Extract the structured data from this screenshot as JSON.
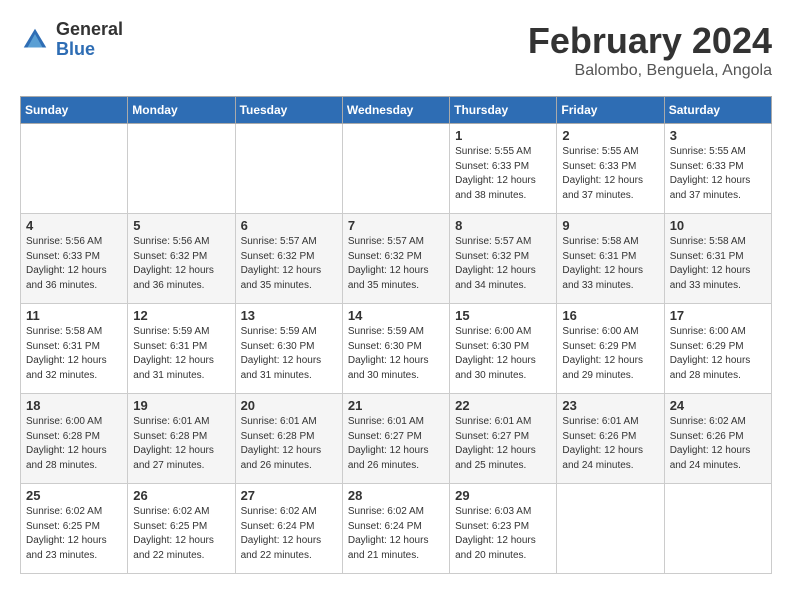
{
  "logo": {
    "general": "General",
    "blue": "Blue"
  },
  "title": "February 2024",
  "location": "Balombo, Benguela, Angola",
  "headers": [
    "Sunday",
    "Monday",
    "Tuesday",
    "Wednesday",
    "Thursday",
    "Friday",
    "Saturday"
  ],
  "weeks": [
    [
      {
        "day": "",
        "info": ""
      },
      {
        "day": "",
        "info": ""
      },
      {
        "day": "",
        "info": ""
      },
      {
        "day": "",
        "info": ""
      },
      {
        "day": "1",
        "info": "Sunrise: 5:55 AM\nSunset: 6:33 PM\nDaylight: 12 hours\nand 38 minutes."
      },
      {
        "day": "2",
        "info": "Sunrise: 5:55 AM\nSunset: 6:33 PM\nDaylight: 12 hours\nand 37 minutes."
      },
      {
        "day": "3",
        "info": "Sunrise: 5:55 AM\nSunset: 6:33 PM\nDaylight: 12 hours\nand 37 minutes."
      }
    ],
    [
      {
        "day": "4",
        "info": "Sunrise: 5:56 AM\nSunset: 6:33 PM\nDaylight: 12 hours\nand 36 minutes."
      },
      {
        "day": "5",
        "info": "Sunrise: 5:56 AM\nSunset: 6:32 PM\nDaylight: 12 hours\nand 36 minutes."
      },
      {
        "day": "6",
        "info": "Sunrise: 5:57 AM\nSunset: 6:32 PM\nDaylight: 12 hours\nand 35 minutes."
      },
      {
        "day": "7",
        "info": "Sunrise: 5:57 AM\nSunset: 6:32 PM\nDaylight: 12 hours\nand 35 minutes."
      },
      {
        "day": "8",
        "info": "Sunrise: 5:57 AM\nSunset: 6:32 PM\nDaylight: 12 hours\nand 34 minutes."
      },
      {
        "day": "9",
        "info": "Sunrise: 5:58 AM\nSunset: 6:31 PM\nDaylight: 12 hours\nand 33 minutes."
      },
      {
        "day": "10",
        "info": "Sunrise: 5:58 AM\nSunset: 6:31 PM\nDaylight: 12 hours\nand 33 minutes."
      }
    ],
    [
      {
        "day": "11",
        "info": "Sunrise: 5:58 AM\nSunset: 6:31 PM\nDaylight: 12 hours\nand 32 minutes."
      },
      {
        "day": "12",
        "info": "Sunrise: 5:59 AM\nSunset: 6:31 PM\nDaylight: 12 hours\nand 31 minutes."
      },
      {
        "day": "13",
        "info": "Sunrise: 5:59 AM\nSunset: 6:30 PM\nDaylight: 12 hours\nand 31 minutes."
      },
      {
        "day": "14",
        "info": "Sunrise: 5:59 AM\nSunset: 6:30 PM\nDaylight: 12 hours\nand 30 minutes."
      },
      {
        "day": "15",
        "info": "Sunrise: 6:00 AM\nSunset: 6:30 PM\nDaylight: 12 hours\nand 30 minutes."
      },
      {
        "day": "16",
        "info": "Sunrise: 6:00 AM\nSunset: 6:29 PM\nDaylight: 12 hours\nand 29 minutes."
      },
      {
        "day": "17",
        "info": "Sunrise: 6:00 AM\nSunset: 6:29 PM\nDaylight: 12 hours\nand 28 minutes."
      }
    ],
    [
      {
        "day": "18",
        "info": "Sunrise: 6:00 AM\nSunset: 6:28 PM\nDaylight: 12 hours\nand 28 minutes."
      },
      {
        "day": "19",
        "info": "Sunrise: 6:01 AM\nSunset: 6:28 PM\nDaylight: 12 hours\nand 27 minutes."
      },
      {
        "day": "20",
        "info": "Sunrise: 6:01 AM\nSunset: 6:28 PM\nDaylight: 12 hours\nand 26 minutes."
      },
      {
        "day": "21",
        "info": "Sunrise: 6:01 AM\nSunset: 6:27 PM\nDaylight: 12 hours\nand 26 minutes."
      },
      {
        "day": "22",
        "info": "Sunrise: 6:01 AM\nSunset: 6:27 PM\nDaylight: 12 hours\nand 25 minutes."
      },
      {
        "day": "23",
        "info": "Sunrise: 6:01 AM\nSunset: 6:26 PM\nDaylight: 12 hours\nand 24 minutes."
      },
      {
        "day": "24",
        "info": "Sunrise: 6:02 AM\nSunset: 6:26 PM\nDaylight: 12 hours\nand 24 minutes."
      }
    ],
    [
      {
        "day": "25",
        "info": "Sunrise: 6:02 AM\nSunset: 6:25 PM\nDaylight: 12 hours\nand 23 minutes."
      },
      {
        "day": "26",
        "info": "Sunrise: 6:02 AM\nSunset: 6:25 PM\nDaylight: 12 hours\nand 22 minutes."
      },
      {
        "day": "27",
        "info": "Sunrise: 6:02 AM\nSunset: 6:24 PM\nDaylight: 12 hours\nand 22 minutes."
      },
      {
        "day": "28",
        "info": "Sunrise: 6:02 AM\nSunset: 6:24 PM\nDaylight: 12 hours\nand 21 minutes."
      },
      {
        "day": "29",
        "info": "Sunrise: 6:03 AM\nSunset: 6:23 PM\nDaylight: 12 hours\nand 20 minutes."
      },
      {
        "day": "",
        "info": ""
      },
      {
        "day": "",
        "info": ""
      }
    ]
  ]
}
